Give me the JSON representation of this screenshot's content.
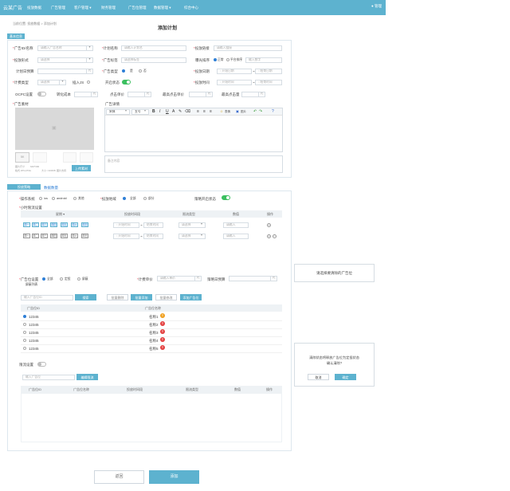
{
  "header": {
    "logo": "云某广告",
    "nav": [
      "投放数据",
      "广告管理",
      "客户管理 ▾",
      "财务管理",
      "广告位管理",
      "数据管理 ▾",
      "综合中心"
    ],
    "user": "管理"
  },
  "breadcrumb": "当前位置: 投放数据 > 添加计划",
  "page_title": "添加计划",
  "basic": {
    "badge": "基本信息",
    "ad_id_label": "广告ID/名称",
    "ad_id_placeholder": "请输入广告名称",
    "plan_name_label": "计划名称",
    "plan_name_placeholder": "请输入计划名",
    "link_label": "投放链接",
    "link_placeholder": "请输入链接",
    "form_label": "投放形式",
    "form_placeholder": "请选择",
    "ad_tag_label": "广告标签",
    "ad_tag_placeholder": "请选择标签",
    "exposure_label": "曝光排序",
    "exposure_options": [
      "正常",
      "平台排序"
    ],
    "exposure_placeholder": "输入数字",
    "daily_budget_label": "计划日预算",
    "unit": "元",
    "ad_type_label": "广告类型",
    "ad_type_options": [
      "是",
      "否"
    ],
    "date_label": "投放日期",
    "start_date": "开始日期",
    "end_date": "结束日期",
    "billing_label": "计费类型",
    "billing_placeholder": "请选择",
    "js_label": "插入JS",
    "status_label": "开启状态",
    "time_label": "投放时间",
    "start_time": "开始时间",
    "end_time": "结束时间",
    "ocpc_label": "OCPC设置",
    "conv_cost_label": "转化成本",
    "click_price_label": "点击单价",
    "max_bid_label": "最高点击单价",
    "max_click_label": "最高点击量",
    "material_label": "广告素材",
    "material_hint": [
      "图片尺寸",
      "640*300",
      "格式:JPG,PNG",
      "大小:<100KB",
      "图片支持"
    ],
    "upload_btn": "上传素材",
    "detail_label": "广告详情",
    "font_family": "宋体",
    "font_size": "五号",
    "editor_emoji": "表情",
    "editor_image": "图片",
    "remark_placeholder": "备注内容"
  },
  "strategy": {
    "tab_active": "投放策略",
    "tab_other": "数据数量",
    "os_label": "操作系统",
    "os_options": [
      "ios",
      "android",
      "其他"
    ],
    "geo_label": "投放地域",
    "geo_options": [
      "全部",
      "部分"
    ],
    "strategy_status_label": "策略开启状态",
    "hourly_label": "小时限流设置",
    "table_headers": [
      "星期",
      "投放时间段",
      "限流类型",
      "数值",
      "操作"
    ],
    "days_row1": [
      "周一",
      "周二",
      "周三",
      "周四",
      "周五",
      "周六",
      "周日"
    ],
    "days_row2": [
      "周一",
      "周二",
      "周三",
      "周四",
      "周五",
      "周六",
      "周日"
    ],
    "start_time": "开始时间",
    "end_time": "结束时间",
    "limit_placeholder": "请选择",
    "value_placeholder": "请输入"
  },
  "slots": {
    "slot_label": "广告位设置",
    "slot_options": [
      "全部",
      "定投",
      "屏蔽"
    ],
    "blacklist_label": "屏蔽列表",
    "cpm_label": "计费单价",
    "cpm_placeholder": "请输入单价",
    "cpm_unit": "元",
    "slot_budget_label": "策略日预算",
    "search_placeholder": "输入广告位ID",
    "search_btn": "搜索",
    "action_btns": [
      "批量删除",
      "批量添加",
      "批量修改",
      "添加广告位"
    ],
    "col_id": "广告位ID",
    "col_name": "广告位名称",
    "rows": [
      {
        "id": "12345",
        "name": "名称1",
        "flag": "warn"
      },
      {
        "id": "12345",
        "name": "名称2",
        "flag": "error"
      },
      {
        "id": "12345",
        "name": "名称3",
        "flag": "error"
      },
      {
        "id": "12345",
        "name": "名称4",
        "flag": "error"
      },
      {
        "id": "12345",
        "name": "名称5",
        "flag": "error"
      }
    ]
  },
  "flow": {
    "label": "限流设置",
    "search_placeholder": "输入广告位",
    "add_btn": "编辑限流",
    "headers": [
      "广告位ID",
      "广告位名称",
      "投放时间段",
      "限流类型",
      "数值",
      "操作"
    ]
  },
  "footer": {
    "back": "返回",
    "submit": "添加"
  },
  "toast": {
    "text": "请选择要清除的广告位"
  },
  "confirm": {
    "text1": "清除状态将释放广告位为定投状态",
    "text2": "确认清除?",
    "cancel": "取消",
    "ok": "确定"
  },
  "colors": {
    "brand": "#5db2cf",
    "warn": "#f0a020",
    "error": "#e34040"
  }
}
